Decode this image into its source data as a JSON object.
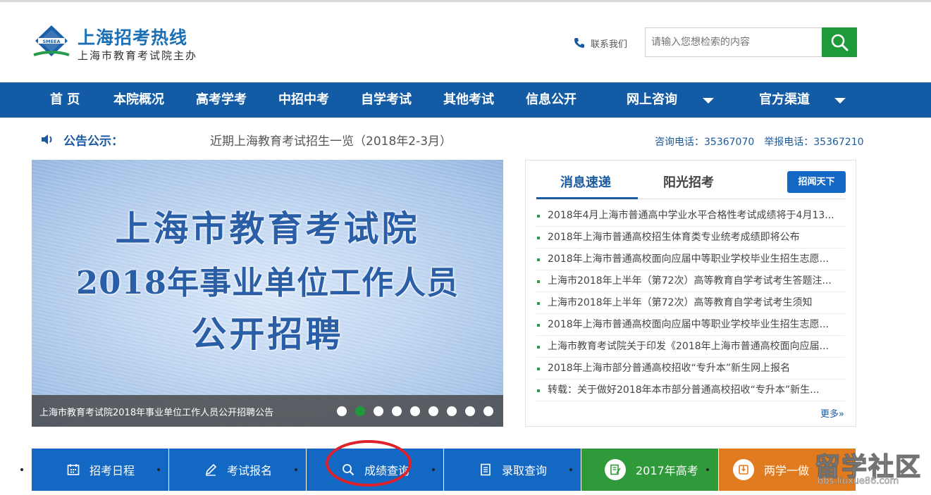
{
  "header": {
    "logo_badge": "SMEEA",
    "site_title": "上海招考热线",
    "site_subtitle": "上海市教育考试院主办",
    "contact_label": "联系我们",
    "search_placeholder": "请输入您想检索的内容"
  },
  "nav": {
    "items": [
      {
        "label": "首 页"
      },
      {
        "label": "本院概况"
      },
      {
        "label": "高考学考"
      },
      {
        "label": "中招中考"
      },
      {
        "label": "自学考试"
      },
      {
        "label": "其他考试"
      },
      {
        "label": "信息公开"
      },
      {
        "label": "网上咨询"
      },
      {
        "label": "官方渠道"
      }
    ]
  },
  "notice": {
    "label": "公告公示：",
    "text": "近期上海教育考试招生一览（2018年2-3月）",
    "hotline": "咨询电话：35367070　举报电话：35367210"
  },
  "banner": {
    "line1": "上海市教育考试院",
    "line2": "2018年事业单位工作人员",
    "line3": "公开招聘",
    "caption": "上海市教育考试院2018年事业单位工作人员公开招聘公告",
    "slide_count": 9,
    "active_slide": 2
  },
  "news": {
    "tab_active": "消息速递",
    "tab_other": "阳光招考",
    "button": "招闻天下",
    "more": "更多»",
    "items": [
      "2018年4月上海市普通高中学业水平合格性考试成绩将于4月13...",
      "2018年上海市普通高校招生体育类专业统考成绩即将公布",
      "2018年上海市普通高校面向应届中等职业学校毕业生招生志愿...",
      "上海市2018年上半年（第72次）高等教育自学考试考生答题注...",
      "上海市2018年上半年（第72次）高等教育自学考试考生须知",
      "2018年上海市普通高校面向应届中等职业学校毕业生招生志愿...",
      "上海市教育考试院关于印发《2018年上海市普通高校面向应届...",
      "2018年上海市部分普通高校招收“专升本”新生网上报名",
      "转载：关于做好2018年本市部分普通高校招收“专升本”新生..."
    ]
  },
  "quick_links": [
    {
      "label": "招考日程",
      "icon": "calendar-icon",
      "color": "#1368c4"
    },
    {
      "label": "考试报名",
      "icon": "pencil-icon",
      "color": "#1368c4"
    },
    {
      "label": "成绩查询",
      "icon": "search-icon",
      "color": "#1368c4"
    },
    {
      "label": "录取查询",
      "icon": "document-icon",
      "color": "#1368c4"
    },
    {
      "label": "2017年高考",
      "icon": "notepad-icon",
      "color": "#2f9a3a"
    },
    {
      "label": "两学一做",
      "icon": "book-icon",
      "color": "#e07b1f"
    }
  ],
  "watermark": {
    "title": "留学社区",
    "url": "bbs.liuxue86.com"
  }
}
